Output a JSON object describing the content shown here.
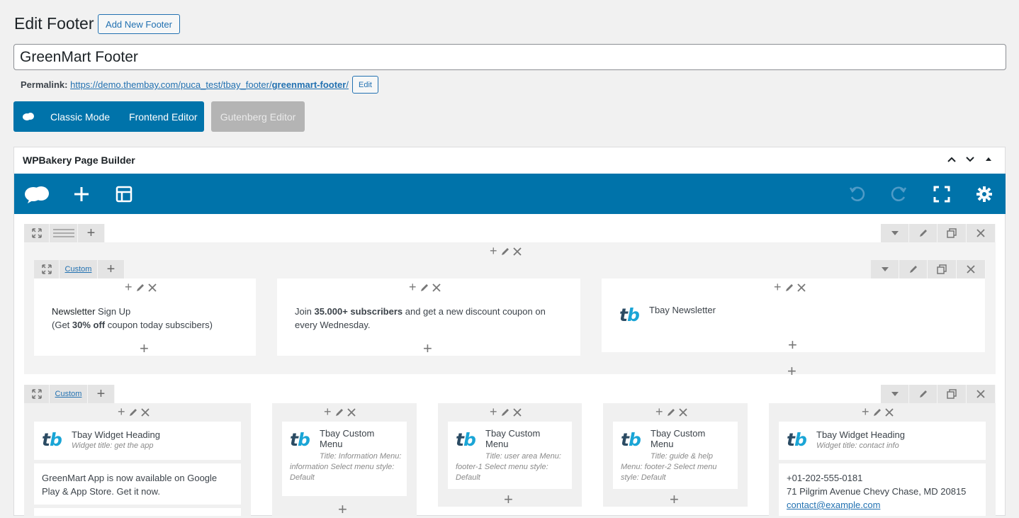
{
  "header": {
    "title": "Edit Footer",
    "add_new_label": "Add New Footer"
  },
  "post_title": "GreenMart Footer",
  "permalink": {
    "label": "Permalink:",
    "url_base": "https://demo.thembay.com/puca_test/tbay_footer/",
    "slug": "greenmart-footer",
    "trail": "/",
    "edit_label": "Edit"
  },
  "modes": {
    "classic_label": "Classic Mode",
    "frontend_label": "Frontend Editor",
    "gutenberg_label": "Gutenberg Editor"
  },
  "builder": {
    "title": "WPBakery Page Builder",
    "accent": "#0073aa",
    "icons": [
      "wpb-logo-icon",
      "add-element-icon",
      "templates-icon",
      "undo-icon",
      "redo-icon",
      "fullscreen-icon",
      "settings-icon"
    ]
  },
  "row1": {
    "inner_label": "Custom",
    "columns": [
      {
        "text_bold1": "Newsletter",
        "text1": " Sign Up",
        "text2_pre": "(Get ",
        "text2_bold": "30% off",
        "text2_post": " coupon today subscibers)"
      },
      {
        "text_pre": "Join ",
        "text_bold": "35.000+ subscribers",
        "text_post": " and get a new discount coupon on every Wednesday."
      },
      {
        "widget_title": "Tbay Newsletter"
      }
    ]
  },
  "row2": {
    "label": "Custom",
    "columns": [
      {
        "widget_title": "Tbay Widget Heading",
        "widget_sub": "Widget title: get the app",
        "body": "GreenMart App is now available on Google Play & App Store. Get it now."
      },
      {
        "widget_title": "Tbay Custom Menu",
        "widget_sub": "Title: Information  Menu: information  Select menu style: Default"
      },
      {
        "widget_title": "Tbay Custom Menu",
        "widget_sub": "Title: user area  Menu: footer-1  Select menu style: Default"
      },
      {
        "widget_title": "Tbay Custom Menu",
        "widget_sub": "Title: guide & help  Menu: footer-2  Select menu style: Default"
      },
      {
        "widget_title": "Tbay Widget Heading",
        "widget_sub": "Widget title: contact info",
        "phone": "+01-202-555-0181",
        "address": "71 Pilgrim Avenue Chevy Chase, MD 20815",
        "email": "contact@example.com"
      }
    ]
  },
  "logo": {
    "t": "t",
    "b": "b"
  }
}
